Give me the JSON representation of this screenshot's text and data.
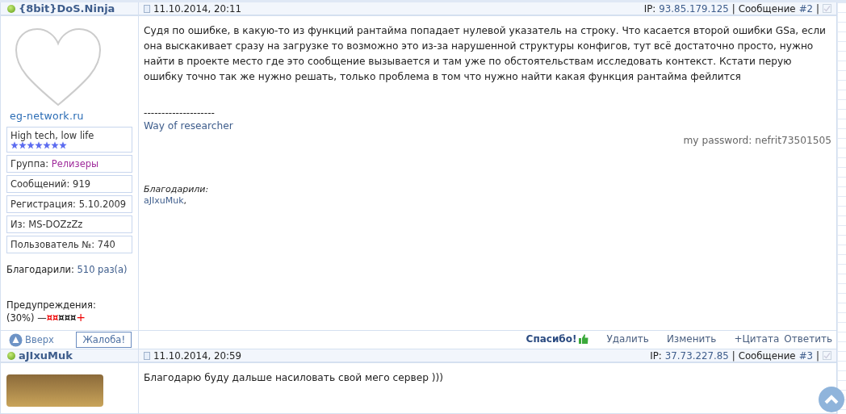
{
  "posts": [
    {
      "author": {
        "name": "{8bit}DoS.Ninja",
        "online": true
      },
      "date": "11.10.2014, 20:11",
      "ip_label": "IP:",
      "ip": "93.85.179.125",
      "separator": "|",
      "post_label": "Сообщение",
      "post_number": "#2",
      "checked": false,
      "profile": {
        "avatar_caption": "eg-network.ru",
        "title": "High tech, low life",
        "stars": 7,
        "fields": [
          {
            "label": "Группа:",
            "value": "Релизеры",
            "kind": "group"
          },
          {
            "label": "Сообщений:",
            "value": "919",
            "kind": "plain"
          },
          {
            "label": "Регистрация:",
            "value": "5.10.2009",
            "kind": "plain"
          },
          {
            "label": "Из:",
            "value": "MS-DOZzZz",
            "kind": "plain"
          },
          {
            "label": "Пользователь №:",
            "value": "740",
            "kind": "plain"
          }
        ],
        "thanks_label": "Благодарили:",
        "thanks_value": "510 раз(а)",
        "warnings_label": "Предупреждения:",
        "warnings_percent": "(30%)",
        "warnings_minus": "—",
        "warnings_marks": [
          {
            "glyph": "¤",
            "active": true
          },
          {
            "glyph": "¤",
            "active": true
          },
          {
            "glyph": "¤",
            "active": false
          },
          {
            "glyph": "¤",
            "active": false
          },
          {
            "glyph": "¤",
            "active": false
          }
        ],
        "warnings_plus": "+"
      },
      "body": "Судя по ошибке, в какую-то из функций рантайма попадает нулевой указатель на строку. Что касается второй ошибки GSa, если она выскакивает сразу на загрузке то возможно это из-за нарушенной структуры конфигов, тут всё достаточно просто, нужно найти в проекте место где это сообщение вызывается и там уже по обстоятельствам исследовать контекст. Кстати перую ошибку точно так же нужно решать, только проблема в том что нужно найти какая функция рантайма фейлится",
      "signature_rule": "--------------------",
      "signature_link": "Way of researcher",
      "signature_note": "my password: nefrit73501505",
      "thanked_label": "Благодарили:",
      "thanked_users": [
        {
          "name": "aJIxuMuk",
          "sep": ","
        }
      ],
      "footer_left": {
        "up": "Вверх",
        "report": "Жалоба!"
      },
      "actions": [
        {
          "label": "Спасибо!",
          "kind": "thanks"
        },
        {
          "label": "Удалить",
          "kind": "plain"
        },
        {
          "label": "Изменить",
          "kind": "plain"
        },
        {
          "label": "+Цитата",
          "kind": "plain"
        },
        {
          "label": "Ответить",
          "kind": "plain"
        }
      ]
    },
    {
      "author": {
        "name": "aJIxuMuk",
        "online": true
      },
      "date": "11.10.2014, 20:59",
      "ip_label": "IP:",
      "ip": "37.73.227.85",
      "separator": "|",
      "post_label": "Сообщение",
      "post_number": "#3",
      "checked": false,
      "body": "Благодарю буду дальше насиловать свой мего сервер )))"
    }
  ]
}
